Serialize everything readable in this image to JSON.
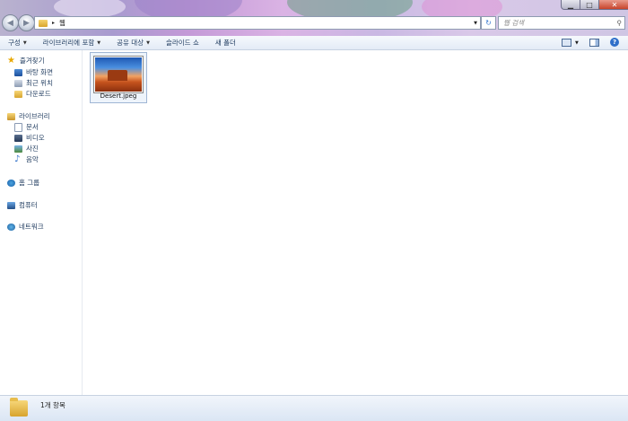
{
  "address_bar": {
    "path_arrow": "▸",
    "current_folder": "웹"
  },
  "search": {
    "placeholder": "웹 검색"
  },
  "window_controls": {
    "minimize": "▁",
    "maximize": "□",
    "close": "✕"
  },
  "toolbar": {
    "items": [
      {
        "label": "구성"
      },
      {
        "label": "라이브러리에 포함"
      },
      {
        "label": "공유 대상"
      },
      {
        "label": "슬라이드 쇼"
      },
      {
        "label": "새 폴더"
      }
    ],
    "dropdown_glyph": "▼"
  },
  "sidebar": {
    "favorites": {
      "label": "즐겨찾기",
      "items": [
        {
          "label": "바탕 화면"
        },
        {
          "label": "최근 위치"
        },
        {
          "label": "다운로드"
        }
      ]
    },
    "libraries": {
      "label": "라이브러리",
      "items": [
        {
          "label": "문서"
        },
        {
          "label": "비디오"
        },
        {
          "label": "사진"
        },
        {
          "label": "음악"
        }
      ]
    },
    "homegroup": {
      "label": "홈 그룹"
    },
    "computer": {
      "label": "컴퓨터"
    },
    "network": {
      "label": "네트워크"
    }
  },
  "files": [
    {
      "name": "Desert.jpeg"
    }
  ],
  "status": {
    "item_count": "1개 항목"
  },
  "colors": {
    "title_gradient_start": "#b9b2cf",
    "toolbar_text": "#1e3a5e",
    "accent": "#3a7ad0"
  }
}
